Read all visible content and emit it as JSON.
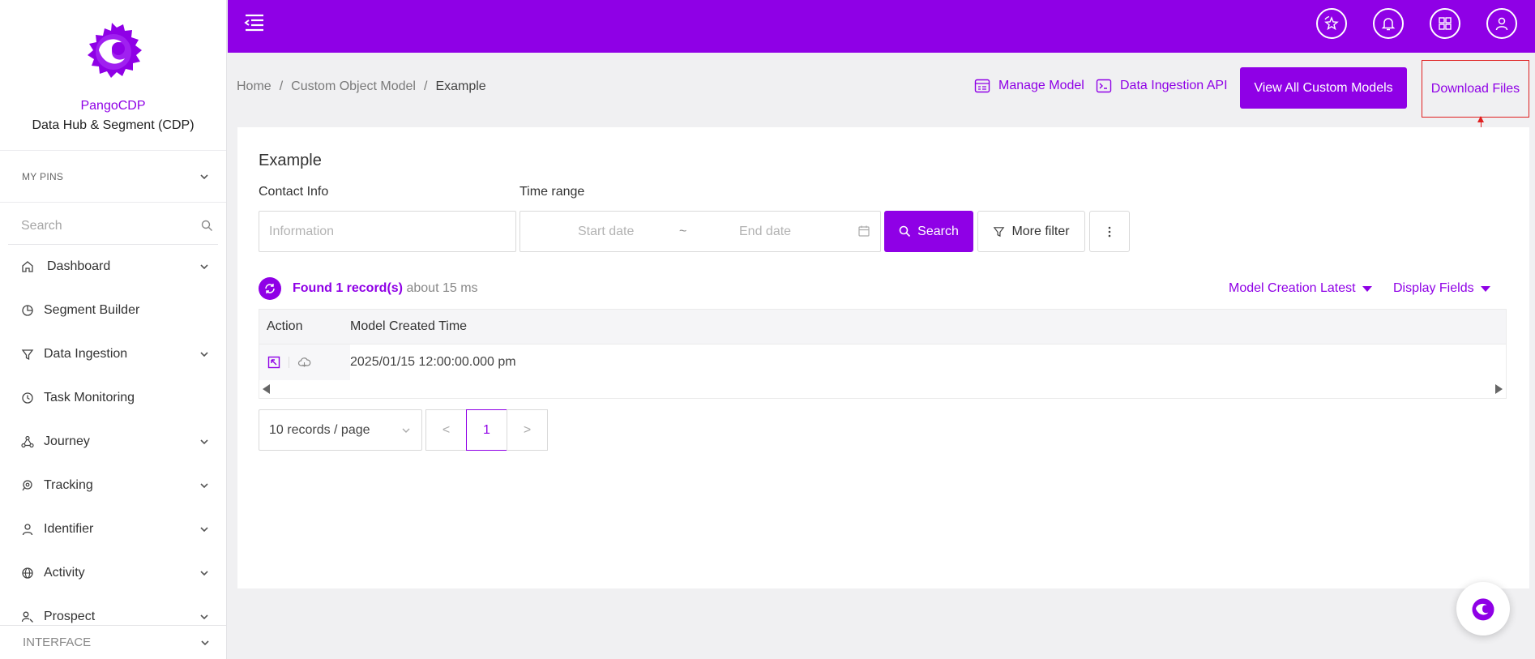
{
  "brand": {
    "name": "PangoCDP",
    "subtitle": "Data Hub & Segment (CDP)"
  },
  "sidebar": {
    "pins_label": "MY PINS",
    "search_placeholder": "Search",
    "items": [
      {
        "label": "Dashboard",
        "icon": "home-icon",
        "expandable": true
      },
      {
        "label": "Segment Builder",
        "icon": "pie-chart-icon",
        "expandable": false
      },
      {
        "label": "Data Ingestion",
        "icon": "funnel-icon",
        "expandable": true
      },
      {
        "label": "Task Monitoring",
        "icon": "clock-icon",
        "expandable": false
      },
      {
        "label": "Journey",
        "icon": "flow-icon",
        "expandable": true
      },
      {
        "label": "Tracking",
        "icon": "radar-icon",
        "expandable": true
      },
      {
        "label": "Identifier",
        "icon": "user-icon",
        "expandable": true
      },
      {
        "label": "Activity",
        "icon": "globe-icon",
        "expandable": true
      },
      {
        "label": "Prospect",
        "icon": "prospect-icon",
        "expandable": true
      }
    ],
    "interface_label": "INTERFACE"
  },
  "topbar": {
    "icons": [
      "menu-icon",
      "favorites-icon",
      "bell-icon",
      "apps-grid-icon",
      "user-profile-icon"
    ]
  },
  "breadcrumb": [
    "Home",
    "Custom Object Model",
    "Example"
  ],
  "breadcrumb_sep": "/",
  "header_actions": {
    "manage_model": "Manage Model",
    "data_ingestion_api": "Data Ingestion API",
    "view_all": "View All Custom Models",
    "download": "Download Files"
  },
  "card": {
    "title": "Example",
    "contact_label": "Contact Info",
    "contact_placeholder": "Information",
    "time_label": "Time range",
    "start_placeholder": "Start date",
    "range_sep": "~",
    "end_placeholder": "End date",
    "search_button": "Search",
    "filter_button": "More filter",
    "found_text": "Found 1 record(s)",
    "found_time": "about 15 ms",
    "sort_label": "Model Creation Latest",
    "display_fields": "Display Fields"
  },
  "table": {
    "columns": [
      "Action",
      "Model Created Time"
    ],
    "rows": [
      {
        "created": "2025/01/15 12:00:00.000 pm"
      }
    ]
  },
  "pagination": {
    "page_size": "10 records / page",
    "prev": "<",
    "current": "1",
    "next": ">"
  },
  "colors": {
    "accent": "#8f00e6",
    "highlight": "#e02020"
  }
}
